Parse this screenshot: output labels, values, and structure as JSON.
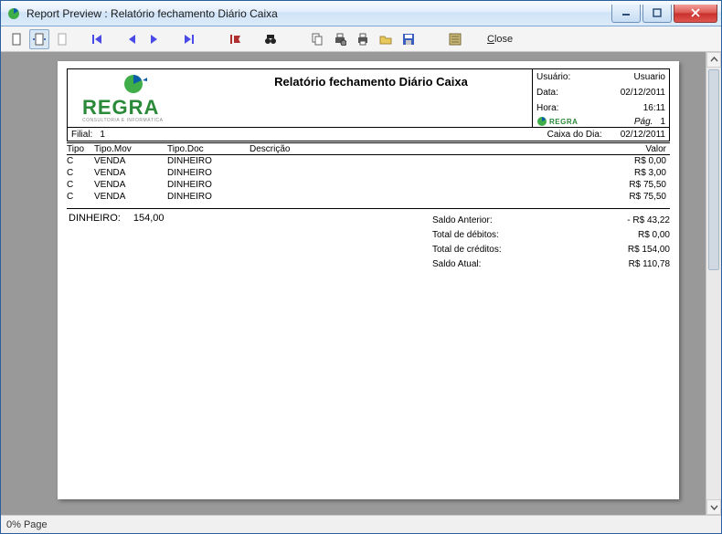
{
  "window": {
    "title": "Report Preview : Relatório fechamento Diário Caixa"
  },
  "toolbar": {
    "close_label": "Close"
  },
  "report": {
    "title": "Relatório fechamento Diário Caixa",
    "user_label": "Usuário:",
    "user_value": "Usuario",
    "date_label": "Data:",
    "date_value": "02/12/2011",
    "time_label": "Hora:",
    "time_value": "16:11",
    "page_label": "Pág.",
    "page_value": "1",
    "filial_label": "Filial:",
    "filial_value": "1",
    "caixa_label": "Caixa do Dia:",
    "caixa_value": "02/12/2011",
    "columns": {
      "tipo": "Tipo",
      "mov": "Tipo.Mov",
      "doc": "Tipo.Doc",
      "desc": "Descrição",
      "valor": "Valor"
    },
    "rows": [
      {
        "tipo": "C",
        "mov": "VENDA",
        "doc": "DINHEIRO",
        "desc": "",
        "valor": "R$ 0,00"
      },
      {
        "tipo": "C",
        "mov": "VENDA",
        "doc": "DINHEIRO",
        "desc": "",
        "valor": "R$ 3,00"
      },
      {
        "tipo": "C",
        "mov": "VENDA",
        "doc": "DINHEIRO",
        "desc": "",
        "valor": "R$ 75,50"
      },
      {
        "tipo": "C",
        "mov": "VENDA",
        "doc": "DINHEIRO",
        "desc": "",
        "valor": "R$ 75,50"
      }
    ],
    "payment": {
      "label": "DINHEIRO:",
      "value": "154,00"
    },
    "summary": [
      {
        "label": "Saldo Anterior:",
        "value": "- R$ 43,22"
      },
      {
        "label": "Total de débitos:",
        "value": "R$ 0,00"
      },
      {
        "label": "Total de créditos:",
        "value": "R$ 154,00"
      },
      {
        "label": "Saldo Atual:",
        "value": "R$ 110,78"
      }
    ]
  },
  "status": {
    "text": "0% Page"
  }
}
